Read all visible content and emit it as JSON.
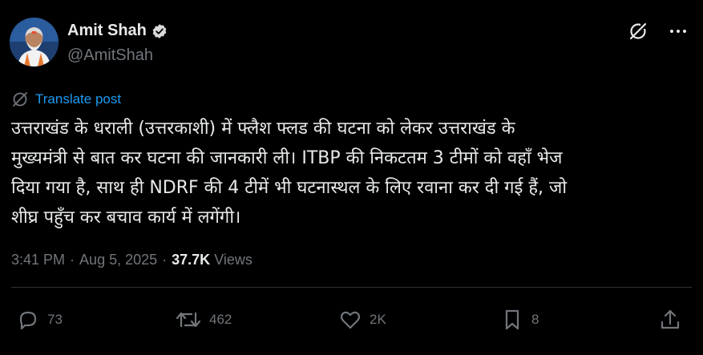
{
  "author": {
    "name": "Amit Shah",
    "handle": "@AmitShah"
  },
  "translate": {
    "label": "Translate post"
  },
  "post": {
    "text": "उत्तराखंड के धराली (उत्तरकाशी) में फ्लैश फ्लड की घटना को लेकर उत्तराखंड के\nमुख्यमंत्री से बात कर घटना की जानकारी ली। ITBP की निकटतम 3 टीमों को वहाँ भेज\nदिया गया है, साथ ही NDRF की 4 टीमें भी घटनास्थल के लिए रवाना कर दी गई हैं, जो\nशीघ्र पहुँच कर बचाव कार्य में लगेंगी।",
    "time": "3:41 PM",
    "date": "Aug 5, 2025",
    "views_count": "37.7K",
    "views_label": "Views"
  },
  "actions": {
    "replies": "73",
    "reposts": "462",
    "likes": "2K",
    "bookmarks": "8"
  },
  "colors": {
    "background": "#000000",
    "text": "#e7e9ea",
    "muted": "#71767b",
    "link": "#1d9bf0",
    "divider": "#2f3336"
  },
  "icons": {
    "verified": "verified-badge-icon",
    "grok": "grok-icon",
    "more": "more-dots-icon",
    "translate": "translate-globe-icon",
    "reply": "reply-bubble-icon",
    "repost": "repost-arrows-icon",
    "like": "heart-icon",
    "bookmark": "bookmark-icon",
    "share": "share-upload-icon"
  }
}
